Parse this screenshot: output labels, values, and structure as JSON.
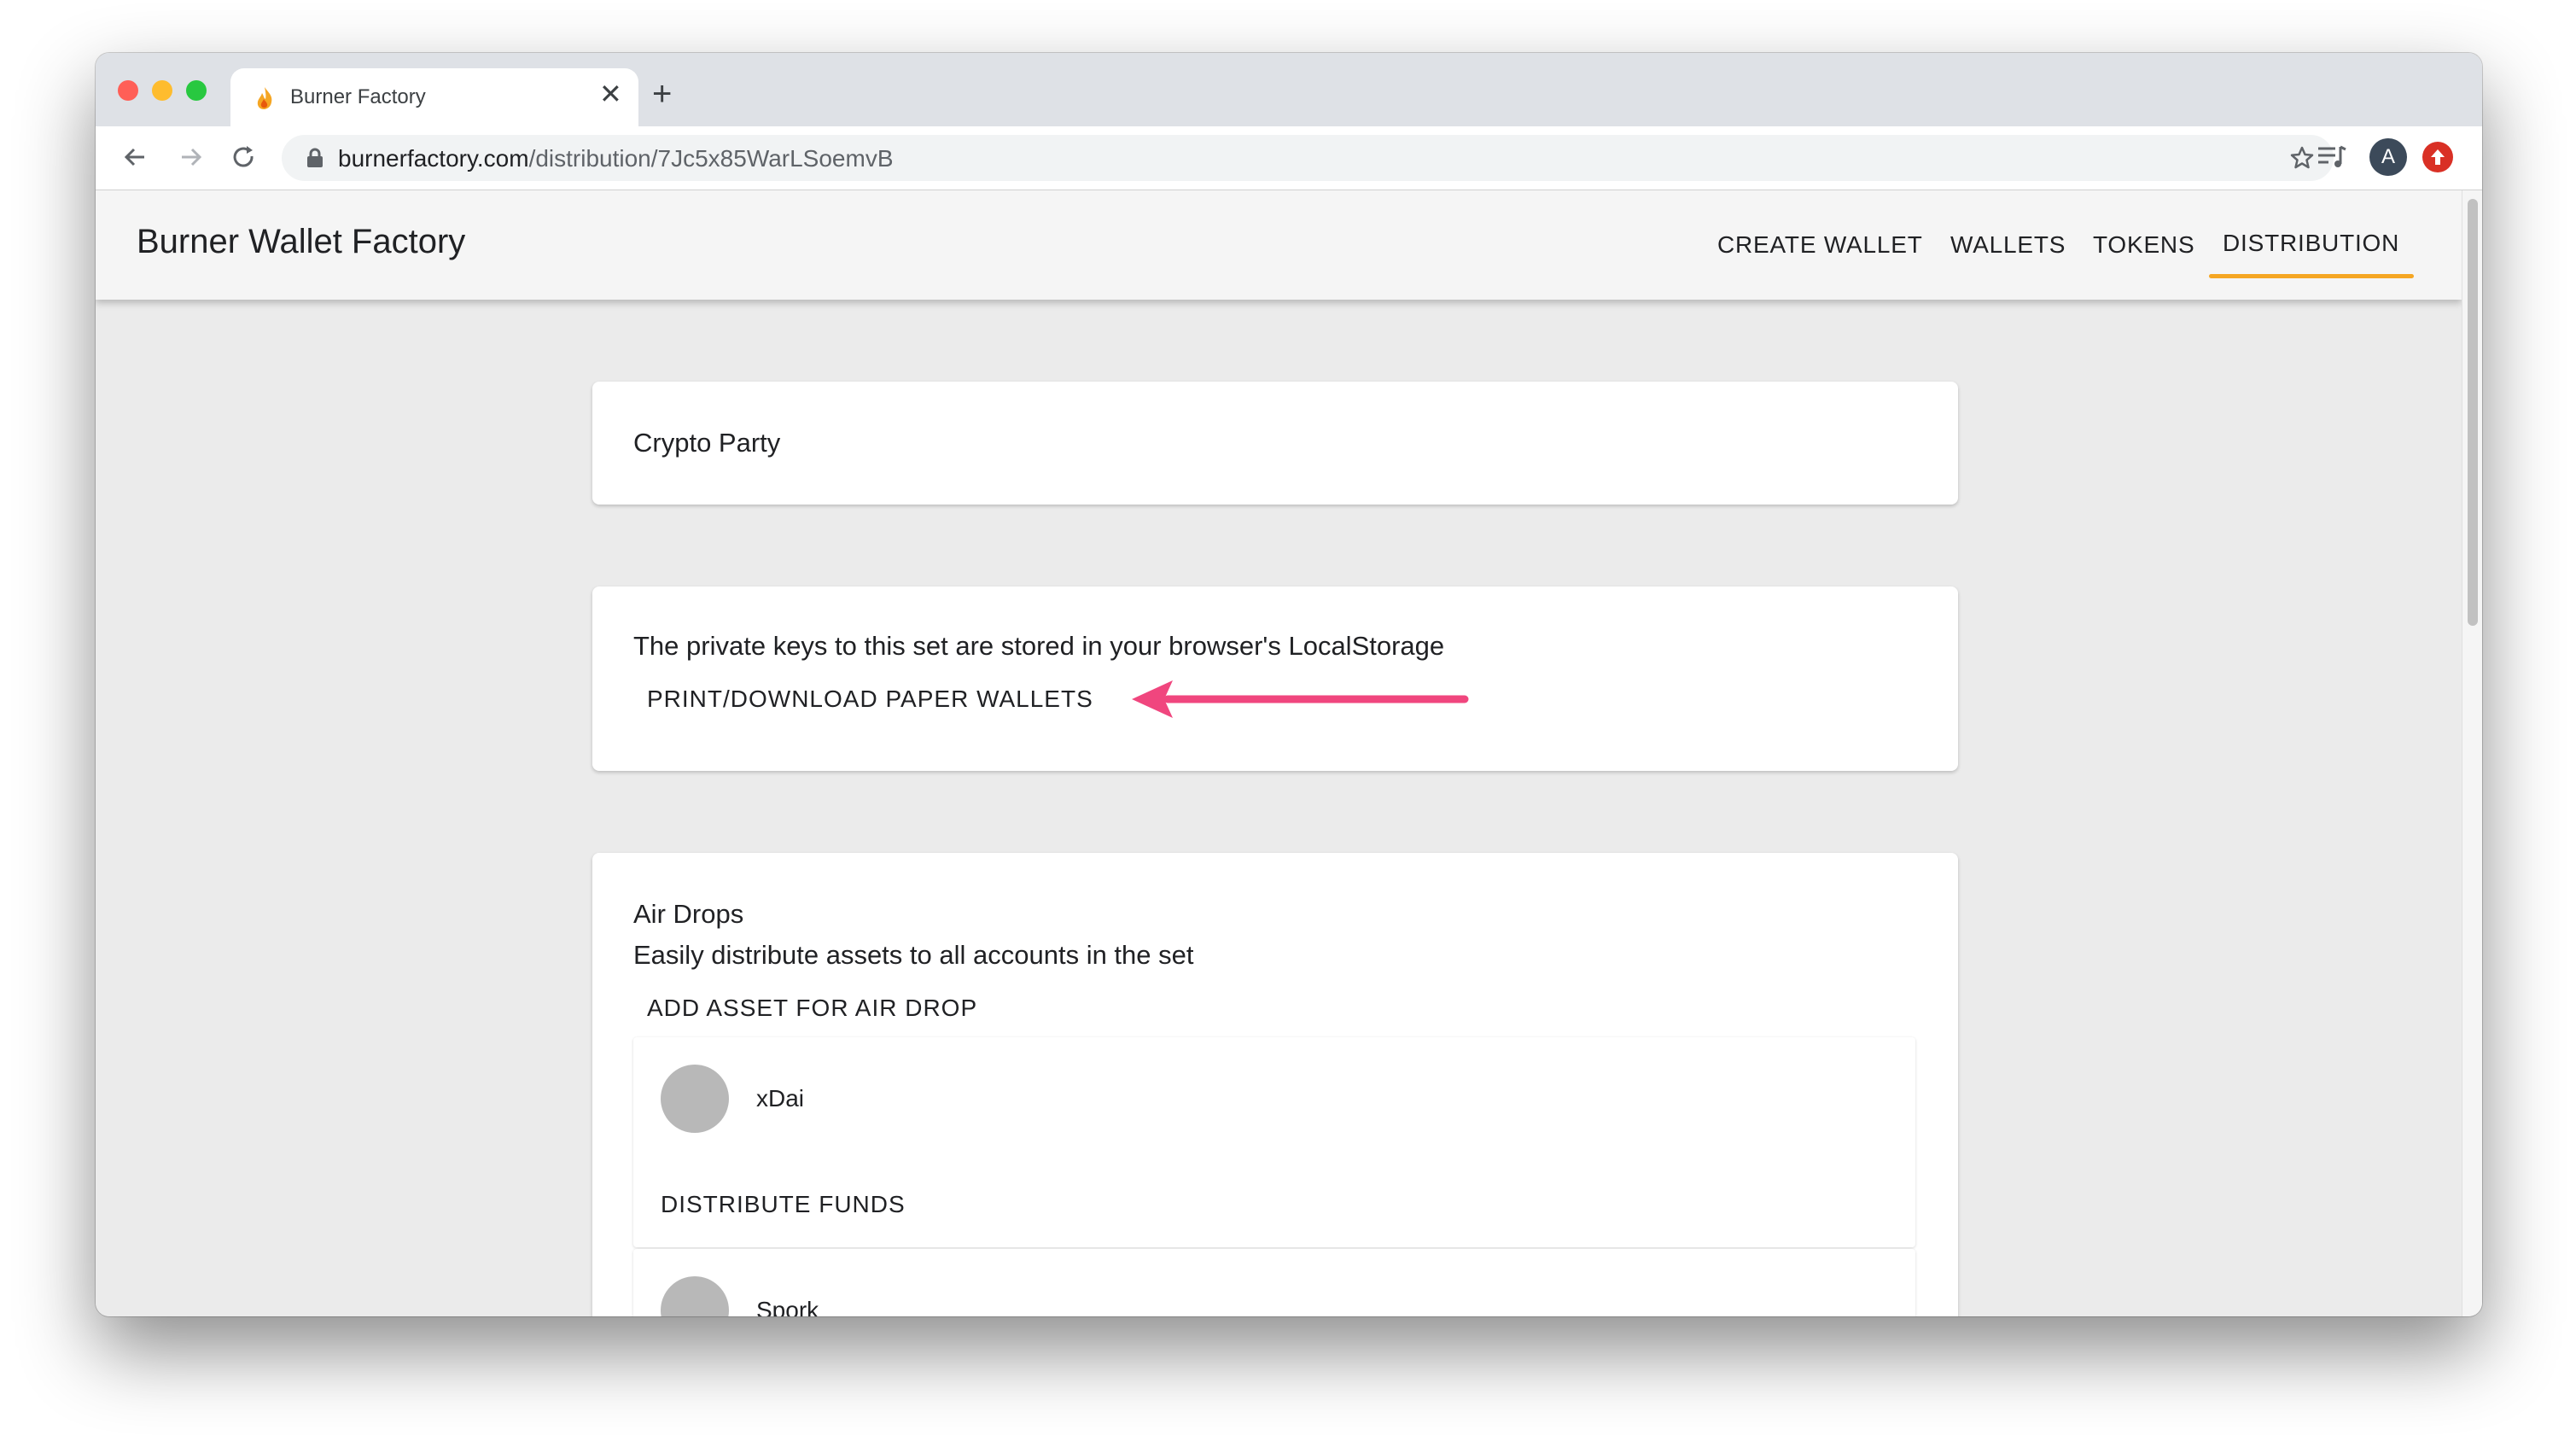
{
  "browser": {
    "tab_title": "Burner Factory",
    "url_host": "burnerfactory.com",
    "url_path": "/distribution/7Jc5x85WarLSoemvB",
    "profile_initial": "A"
  },
  "app": {
    "brand": "Burner Wallet Factory",
    "nav": {
      "create_wallet": "CREATE WALLET",
      "wallets": "WALLETS",
      "tokens": "TOKENS",
      "distribution": "DISTRIBUTION"
    },
    "active_nav": "DISTRIBUTION",
    "accent_color": "#f5a623"
  },
  "main": {
    "set_name": "Crypto Party",
    "storage_notice": "The private keys to this set are stored in your browser's LocalStorage",
    "print_button": "PRINT/DOWNLOAD PAPER WALLETS",
    "annotation_arrow_color": "#f0467e",
    "airdrops": {
      "title": "Air Drops",
      "subtitle": "Easily distribute assets to all accounts in the set",
      "add_button": "ADD ASSET FOR AIR DROP",
      "assets": [
        {
          "name": "xDai",
          "action": "DISTRIBUTE FUNDS"
        },
        {
          "name": "Spork"
        }
      ]
    }
  }
}
